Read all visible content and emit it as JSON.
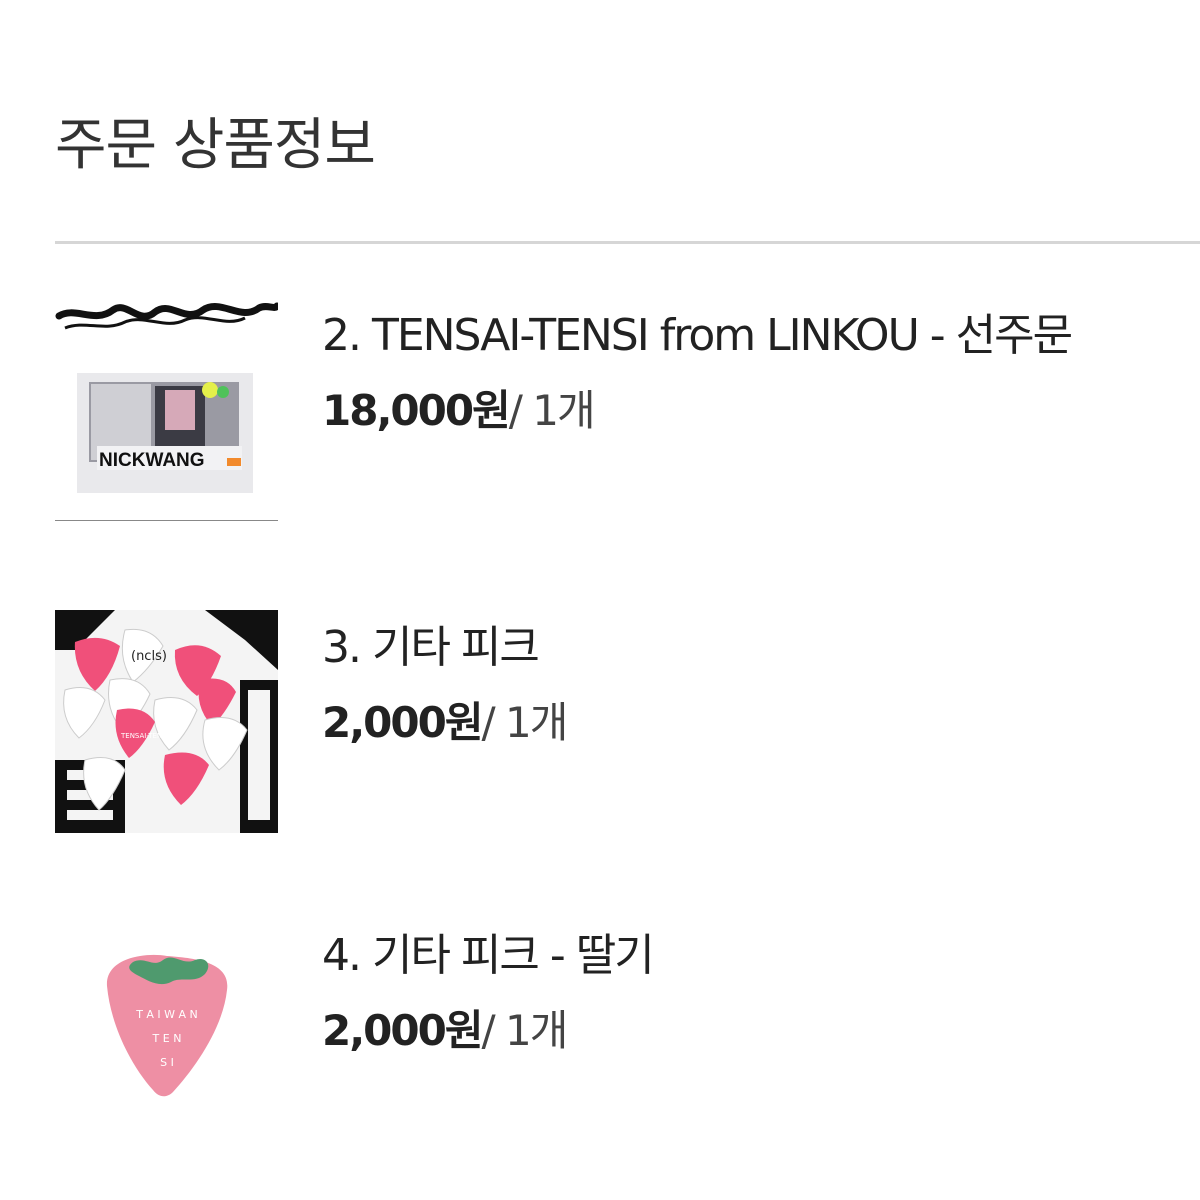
{
  "header": {
    "title": "주문 상품정보"
  },
  "items": [
    {
      "name": "2. TENSAI-TENSI from LINKOU - 선주문",
      "price": "18,000원",
      "qty": "/ 1개",
      "image_icon": "album-package-image",
      "image_text": "NICKWANG"
    },
    {
      "name": "3. 기타 피크",
      "price": "2,000원",
      "qty": "/ 1개",
      "image_icon": "guitar-picks-image",
      "image_text_1": "(ncls)",
      "image_text_2": "TENSAI-TENSI"
    },
    {
      "name": "4. 기타 피크 - 딸기",
      "price": "2,000원",
      "qty": "/ 1개",
      "image_icon": "strawberry-pick-image",
      "image_text_1": "T A I W A N",
      "image_text_2": "T E N",
      "image_text_3": "S I"
    }
  ],
  "colors": {
    "pick_pink": "#f0507a",
    "strawberry_pink": "#ee8fa4",
    "leaf_green": "#4f9a6e",
    "divider": "#d6d6d6"
  }
}
